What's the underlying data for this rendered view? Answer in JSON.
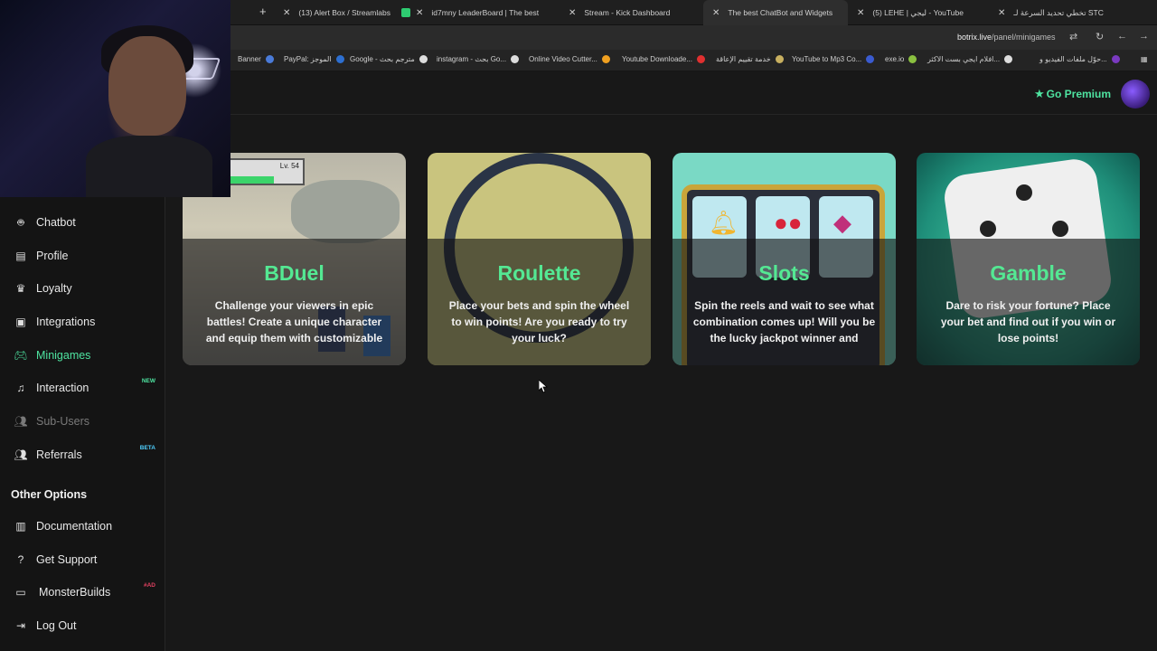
{
  "browser": {
    "tabs": [
      {
        "label": "(13) Alert Box / Streamlabs"
      },
      {
        "label": "id7mny LeaderBoard | The best"
      },
      {
        "label": "Stream - Kick Dashboard"
      },
      {
        "label": "The best ChatBot and Widgets"
      },
      {
        "label": "(5) LEHE | ليجي - YouTube"
      },
      {
        "label": "تخطي تحديد السرعة لـ STC"
      }
    ],
    "url_domain": "botrix.live",
    "url_path": "/panel/minigames",
    "bookmarks": [
      "Banner",
      "PayPal: الموجز",
      "Google - مترجم بحث",
      "instagram - بحث Go...",
      "Online Video Cutter...",
      "Youtube Downloade...",
      "خدمة تقييم الإعاقة",
      "YouTube to Mp3 Co...",
      "exe.io",
      "افلام ايجي بست الاكثر...",
      "حوّل ملفات الفيديو و..."
    ]
  },
  "header": {
    "premium_label": "Go Premium"
  },
  "sidebar": {
    "items": [
      {
        "label": "Chatbot",
        "icon": "robot-icon"
      },
      {
        "label": "Profile",
        "icon": "id-card-icon"
      },
      {
        "label": "Loyalty",
        "icon": "trophy-icon"
      },
      {
        "label": "Integrations",
        "icon": "plug-icon"
      },
      {
        "label": "Minigames",
        "icon": "gamepad-icon"
      },
      {
        "label": "Interaction",
        "icon": "music-note-icon",
        "badge": "NEW"
      },
      {
        "label": "Sub-Users",
        "icon": "users-icon"
      },
      {
        "label": "Referrals",
        "icon": "users-icon",
        "badge": "BETA"
      }
    ],
    "other_options_heading": "Other Options",
    "other_items": [
      {
        "label": "Documentation",
        "icon": "book-icon"
      },
      {
        "label": "Get Support",
        "icon": "question-icon"
      },
      {
        "label": "MonsterBuilds",
        "icon": "laptop-icon",
        "badge": "#AD"
      },
      {
        "label": "Log Out",
        "icon": "sign-out-icon"
      }
    ]
  },
  "minigames": [
    {
      "title": "BDuel",
      "description": "Challenge your viewers in epic battles! Create a unique character and equip them with customizable"
    },
    {
      "title": "Roulette",
      "description": "Place your bets and spin the wheel to win points! Are you ready to try your luck?"
    },
    {
      "title": "Slots",
      "description": "Spin the reels and wait to see what combination comes up! Will you be the lucky jackpot winner and"
    },
    {
      "title": "Gamble",
      "description": "Dare to risk your fortune? Place your bet and find out if you win or lose points!"
    }
  ],
  "bduel_art_level": "Lv. 54",
  "colors": {
    "accent_green": "#4ee3a0",
    "card_title_green": "#54e893",
    "badge_new": "#4ee3a0",
    "badge_beta": "#4fd0ff",
    "badge_ad": "#e04060",
    "page_bg": "#181818"
  }
}
